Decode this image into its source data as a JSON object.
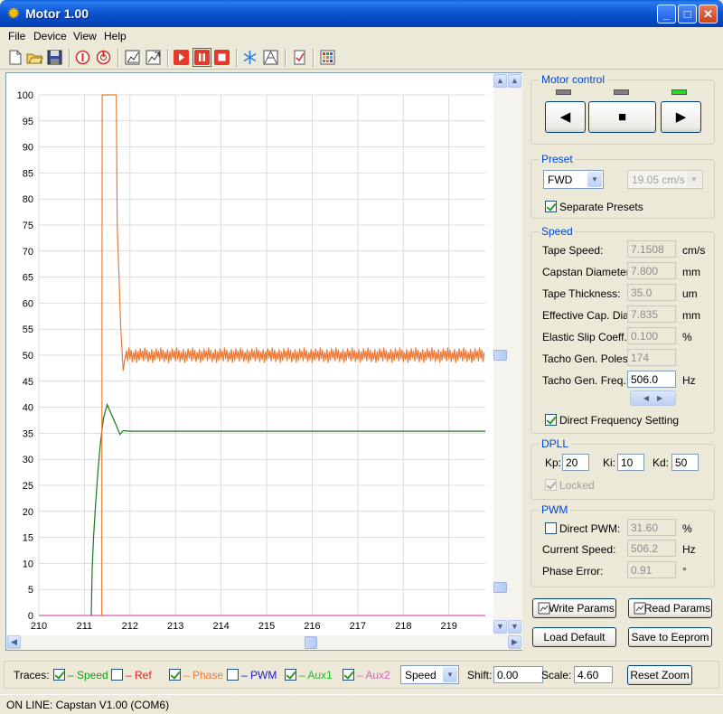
{
  "window": {
    "title": "Motor 1.00"
  },
  "menu": [
    "File",
    "Device",
    "View",
    "Help"
  ],
  "toolbar_icons": [
    "new-icon",
    "open-icon",
    "save-icon",
    "connect-icon",
    "disconnect-icon",
    "chart-icon",
    "chart-export-icon",
    "run-icon",
    "pause-icon",
    "stop-icon",
    "snowflake-icon",
    "graph-icon",
    "check-document-icon",
    "palette-icon"
  ],
  "chart_data": {
    "type": "line",
    "xlim": [
      210,
      219.8
    ],
    "ylim": [
      0,
      100
    ],
    "x_ticks": [
      "210",
      "211",
      "212",
      "213",
      "214",
      "215",
      "216",
      "217",
      "218",
      "219"
    ],
    "y_ticks": [
      "0",
      "5",
      "10",
      "15",
      "20",
      "25",
      "30",
      "35",
      "40",
      "45",
      "50",
      "55",
      "60",
      "65",
      "70",
      "75",
      "80",
      "85",
      "90",
      "95",
      "100"
    ],
    "grid": true,
    "series": [
      {
        "name": "Speed",
        "color": "#1a7a1a",
        "x": [
          211.15,
          211.17,
          211.2,
          211.25,
          211.3,
          211.35,
          211.42,
          211.5,
          211.6,
          211.7,
          211.78,
          211.85,
          212,
          219.8
        ],
        "y": [
          0,
          9,
          15,
          22,
          28,
          33,
          38,
          40.5,
          38.5,
          36.5,
          34.8,
          35.5,
          35.4,
          35.4
        ]
      },
      {
        "name": "Phase",
        "color": "#ec7a36",
        "x": [
          211.38,
          211.39,
          211.7,
          211.72,
          211.8,
          211.85,
          211.9,
          219.8
        ],
        "y": [
          0,
          100,
          100,
          75,
          55,
          47,
          50,
          50
        ]
      }
    ]
  },
  "motor": {
    "title": "Motor control",
    "leds": [
      false,
      false,
      true
    ],
    "back": "◀",
    "stop": "■",
    "fwd": "▶"
  },
  "preset": {
    "title": "Preset",
    "direction": "FWD",
    "speed_preset": "19.05 cm/s",
    "separate": "Separate Presets"
  },
  "speed": {
    "title": "Speed",
    "rows": [
      {
        "label": "Tape Speed:",
        "value": "7.1508",
        "unit": "cm/s",
        "enabled": false
      },
      {
        "label": "Capstan Diameter:",
        "value": "7.800",
        "unit": "mm",
        "enabled": false
      },
      {
        "label": "Tape Thickness:",
        "value": "35.0",
        "unit": "um",
        "enabled": false
      },
      {
        "label": "Effective Cap. Dia:",
        "value": "7.835",
        "unit": "mm",
        "enabled": false
      },
      {
        "label": "Elastic Slip Coeff.:",
        "value": "0.100",
        "unit": "%",
        "enabled": false
      },
      {
        "label": "Tacho Gen. Poles:",
        "value": "174",
        "unit": "",
        "enabled": false
      },
      {
        "label": "Tacho Gen. Freq.:",
        "value": "506.0",
        "unit": "Hz",
        "enabled": true
      }
    ],
    "direct": "Direct Frequency Setting"
  },
  "dpll": {
    "title": "DPLL",
    "kp_label": "Kp:",
    "kp": "20",
    "ki_label": "Ki:",
    "ki": "10",
    "kd_label": "Kd:",
    "kd": "50",
    "locked": "Locked"
  },
  "pwm": {
    "title": "PWM",
    "direct_label": "Direct PWM:",
    "direct_value": "31.60",
    "direct_unit": "%",
    "speed_label": "Current Speed:",
    "speed_value": "506.2",
    "speed_unit": "Hz",
    "error_label": "Phase Error:",
    "error_value": "0.91",
    "error_unit": "°"
  },
  "buttons": {
    "write": "Write Params",
    "read": "Read Params",
    "load": "Load Default",
    "eeprom": "Save to Eeprom"
  },
  "traces": {
    "label": "Traces:",
    "items": [
      {
        "label": "– Speed",
        "checked": true,
        "color": "#1a9a1a"
      },
      {
        "label": "– Ref",
        "checked": false,
        "color": "#e02020"
      },
      {
        "label": "– Phase",
        "checked": true,
        "color": "#ec7a36"
      },
      {
        "label": "– PWM",
        "checked": false,
        "color": "#1a1ad0"
      },
      {
        "label": "– Aux1",
        "checked": true,
        "color": "#20c020"
      },
      {
        "label": "– Aux2",
        "checked": true,
        "color": "#e060c0"
      }
    ],
    "select": "Speed",
    "shift_label": "Shift:",
    "shift": "0.00",
    "scale_label": "Scale:",
    "scale": "4.60",
    "reset": "Reset Zoom"
  },
  "status": "ON LINE: Capstan V1.00 (COM6)"
}
